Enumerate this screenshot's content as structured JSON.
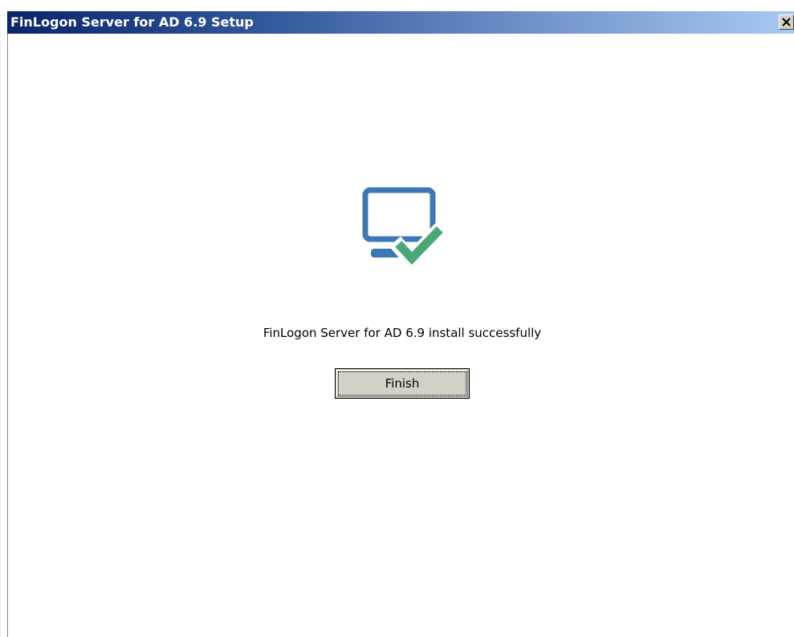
{
  "window": {
    "title": "FinLogon Server for AD 6.9 Setup",
    "close_symbol": "✕"
  },
  "main": {
    "icon": "monitor-check-icon",
    "message": "FinLogon Server for AD 6.9 install successfully",
    "finish_label": "Finish"
  },
  "colors": {
    "title_gradient_start": "#0a246a",
    "title_gradient_end": "#a6caf0",
    "monitor_blue": "#3b78b5",
    "check_green": "#4aa878",
    "button_face": "#d4d0c8"
  }
}
